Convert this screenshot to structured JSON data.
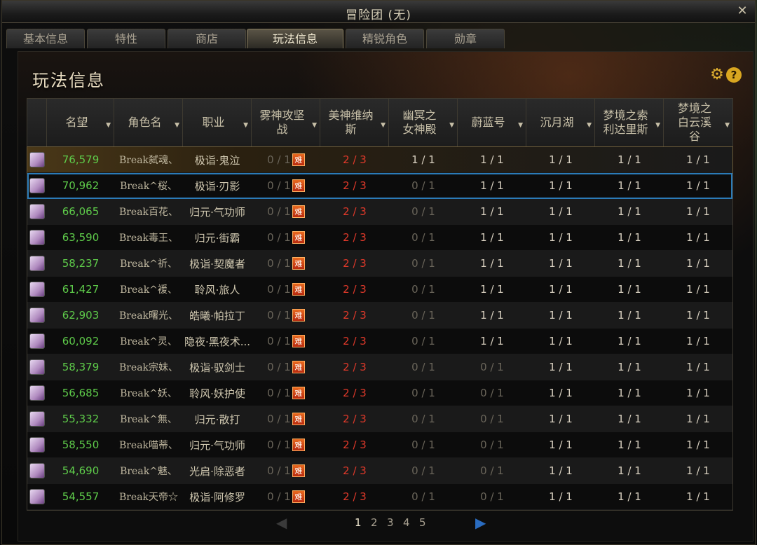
{
  "window": {
    "title": "冒险团 (无)",
    "close_glyph": "✕"
  },
  "tabs": [
    {
      "label": "基本信息"
    },
    {
      "label": "特性"
    },
    {
      "label": "商店"
    },
    {
      "label": "玩法信息",
      "active": true
    },
    {
      "label": "精锐角色"
    },
    {
      "label": "勋章"
    }
  ],
  "panel": {
    "title": "玩法信息",
    "settings_icon": "gear-icon",
    "help_icon": "help-icon",
    "help_glyph": "?"
  },
  "columns": [
    "名望",
    "角色名",
    "职业",
    "雾神攻坚战",
    "美神维纳斯",
    "幽冥之女神殿",
    "蔚蓝号",
    "沉月湖",
    "梦境之索利达里斯",
    "梦境之白云溪谷"
  ],
  "hard_badge": "难",
  "rows": [
    {
      "rep": "76,579",
      "name": "Break弑魂、",
      "job": "极诣·鬼泣",
      "c1": "0 / 1",
      "c2": "2 / 3",
      "c3": "1 / 1",
      "c4": "1 / 1",
      "c5": "1 / 1",
      "c6": "1 / 1",
      "c7": "1 / 1"
    },
    {
      "rep": "70,962",
      "name": "Break^桜、",
      "job": "极诣·刃影",
      "c1": "0 / 1",
      "c2": "2 / 3",
      "c3": "0 / 1",
      "c4": "1 / 1",
      "c5": "1 / 1",
      "c6": "1 / 1",
      "c7": "1 / 1"
    },
    {
      "rep": "66,065",
      "name": "Break百花、",
      "job": "归元·气功师",
      "c1": "0 / 1",
      "c2": "2 / 3",
      "c3": "0 / 1",
      "c4": "1 / 1",
      "c5": "1 / 1",
      "c6": "1 / 1",
      "c7": "1 / 1"
    },
    {
      "rep": "63,590",
      "name": "Break毒王、",
      "job": "归元·街霸",
      "c1": "0 / 1",
      "c2": "2 / 3",
      "c3": "0 / 1",
      "c4": "1 / 1",
      "c5": "1 / 1",
      "c6": "1 / 1",
      "c7": "1 / 1"
    },
    {
      "rep": "58,237",
      "name": "Break^祈、",
      "job": "极诣·契魔者",
      "c1": "0 / 1",
      "c2": "2 / 3",
      "c3": "0 / 1",
      "c4": "1 / 1",
      "c5": "1 / 1",
      "c6": "1 / 1",
      "c7": "1 / 1"
    },
    {
      "rep": "61,427",
      "name": "Break^褑、",
      "job": "聆风·旅人",
      "c1": "0 / 1",
      "c2": "2 / 3",
      "c3": "0 / 1",
      "c4": "1 / 1",
      "c5": "1 / 1",
      "c6": "1 / 1",
      "c7": "1 / 1"
    },
    {
      "rep": "62,903",
      "name": "Break曙光、",
      "job": "皓曦·帕拉丁",
      "c1": "0 / 1",
      "c2": "2 / 3",
      "c3": "0 / 1",
      "c4": "1 / 1",
      "c5": "1 / 1",
      "c6": "1 / 1",
      "c7": "1 / 1"
    },
    {
      "rep": "60,092",
      "name": "Break^灵、",
      "job": "隐夜·黑夜术...",
      "c1": "0 / 1",
      "c2": "2 / 3",
      "c3": "0 / 1",
      "c4": "1 / 1",
      "c5": "1 / 1",
      "c6": "1 / 1",
      "c7": "1 / 1"
    },
    {
      "rep": "58,379",
      "name": "Break宗妹、",
      "job": "极诣·驭剑士",
      "c1": "0 / 1",
      "c2": "2 / 3",
      "c3": "0 / 1",
      "c4": "0 / 1",
      "c5": "1 / 1",
      "c6": "1 / 1",
      "c7": "1 / 1"
    },
    {
      "rep": "56,685",
      "name": "Break^妖、",
      "job": "聆风·妖护使",
      "c1": "0 / 1",
      "c2": "2 / 3",
      "c3": "0 / 1",
      "c4": "0 / 1",
      "c5": "1 / 1",
      "c6": "1 / 1",
      "c7": "1 / 1"
    },
    {
      "rep": "55,332",
      "name": "Break^無、",
      "job": "归元·散打",
      "c1": "0 / 1",
      "c2": "2 / 3",
      "c3": "0 / 1",
      "c4": "0 / 1",
      "c5": "1 / 1",
      "c6": "1 / 1",
      "c7": "1 / 1"
    },
    {
      "rep": "58,550",
      "name": "Break喵蒂、",
      "job": "归元·气功师",
      "c1": "0 / 1",
      "c2": "2 / 3",
      "c3": "0 / 1",
      "c4": "0 / 1",
      "c5": "1 / 1",
      "c6": "1 / 1",
      "c7": "1 / 1"
    },
    {
      "rep": "54,690",
      "name": "Break^魅、",
      "job": "光启·除恶者",
      "c1": "0 / 1",
      "c2": "2 / 3",
      "c3": "0 / 1",
      "c4": "0 / 1",
      "c5": "1 / 1",
      "c6": "1 / 1",
      "c7": "1 / 1"
    },
    {
      "rep": "54,557",
      "name": "Break天帝☆",
      "job": "极诣·阿修罗",
      "c1": "0 / 1",
      "c2": "2 / 3",
      "c3": "0 / 1",
      "c4": "0 / 1",
      "c5": "1 / 1",
      "c6": "1 / 1",
      "c7": "1 / 1"
    }
  ],
  "pagination": {
    "pages": [
      "1",
      "2",
      "3",
      "4",
      "5"
    ],
    "current": "1",
    "prev_glyph": "◀",
    "next_glyph": "▶"
  },
  "colors": {
    "reputation": "#5ecb4a",
    "progress_red": "#e0392a",
    "selection": "#2b7bb8",
    "hard_badge": "#e86a20"
  }
}
